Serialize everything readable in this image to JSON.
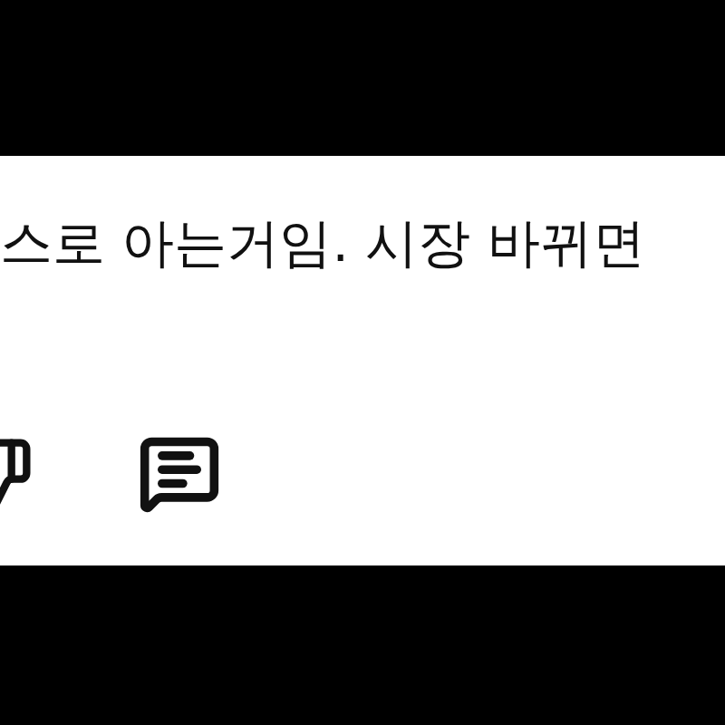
{
  "comment": {
    "text": "스로 아는거임. 시장 바뀌면"
  }
}
